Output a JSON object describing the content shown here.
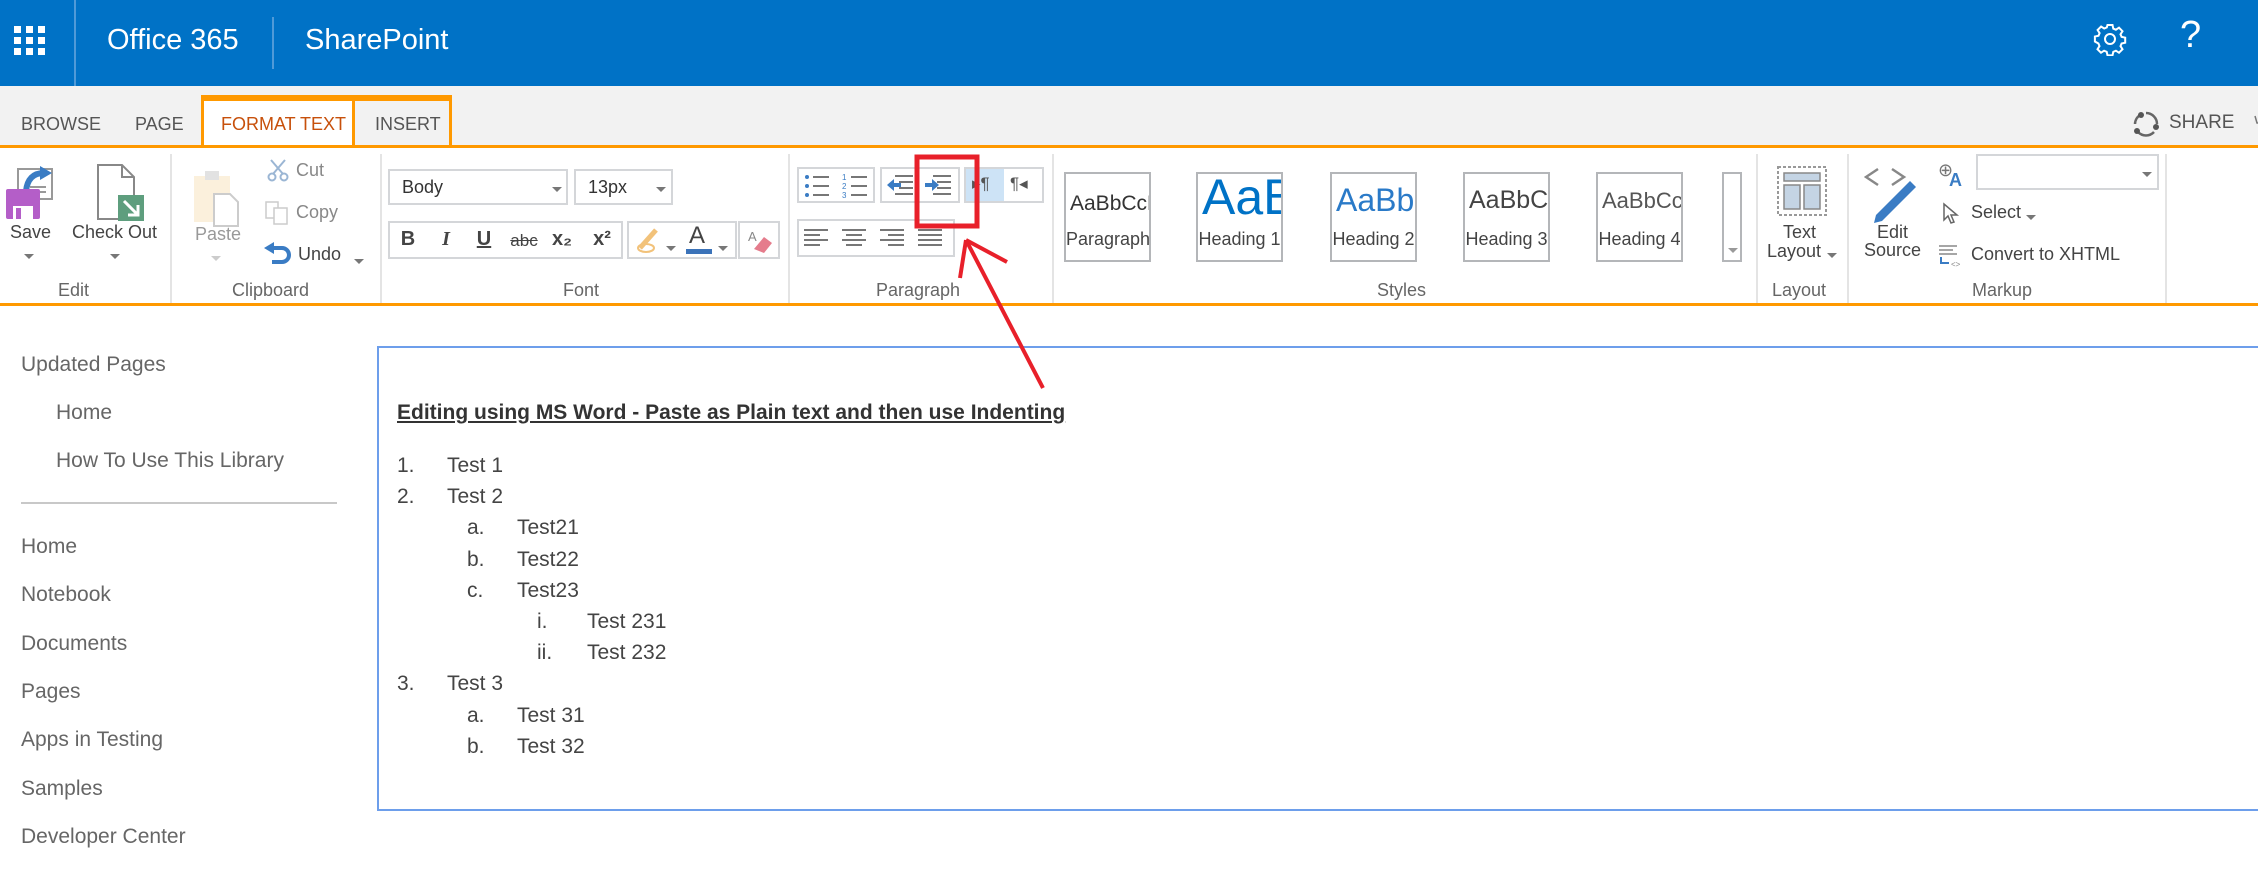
{
  "suitebar": {
    "app_launcher_icon": "waffle-icon",
    "brand": "Office 365",
    "app": "SharePoint",
    "settings_icon": "gear-icon",
    "help_label": "?"
  },
  "tabs": {
    "items": [
      {
        "label": "BROWSE"
      },
      {
        "label": "PAGE"
      },
      {
        "label": "FORMAT TEXT",
        "active": true
      },
      {
        "label": "INSERT"
      }
    ],
    "share_label": "SHARE"
  },
  "ribbon": {
    "edit": {
      "group_label": "Edit",
      "save_label": "Save",
      "checkout_label": "Check Out"
    },
    "clipboard": {
      "group_label": "Clipboard",
      "paste_label": "Paste",
      "cut_label": "Cut",
      "copy_label": "Copy",
      "undo_label": "Undo"
    },
    "font": {
      "group_label": "Font",
      "font_family_value": "Body",
      "font_size_value": "13px",
      "bold_label": "B",
      "italic_label": "I",
      "underline_label": "U",
      "strike_label": "abc",
      "subscript_label": "x₂",
      "superscript_label": "x²",
      "font_color": "#3b73b9"
    },
    "paragraph": {
      "group_label": "Paragraph"
    },
    "styles": {
      "group_label": "Styles",
      "items": [
        {
          "sample": "AaBbCcDdEe",
          "name": "Paragraph",
          "color": "#333333"
        },
        {
          "sample": "AaBb",
          "name": "Heading 1",
          "color": "#0072c6"
        },
        {
          "sample": "AaBbCc",
          "name": "Heading 2",
          "color": "#2a7ac8"
        },
        {
          "sample": "AaBbCcDd",
          "name": "Heading 3",
          "color": "#444444"
        },
        {
          "sample": "AaBbCcDdE",
          "name": "Heading 4",
          "color": "#555555"
        }
      ]
    },
    "layout": {
      "group_label": "Layout",
      "text_layout_line1": "Text",
      "text_layout_line2": "Layout"
    },
    "markup": {
      "group_label": "Markup",
      "edit_source_line1": "Edit",
      "edit_source_line2": "Source",
      "language_value": "",
      "select_label": "Select",
      "convert_label": "Convert to XHTML"
    }
  },
  "nav": {
    "recent_header": "Updated Pages",
    "recent": [
      "Home",
      "How To Use This Library"
    ],
    "items": [
      "Home",
      "Notebook",
      "Documents",
      "Pages",
      "Apps in Testing",
      "Samples",
      "Developer Center"
    ]
  },
  "document": {
    "title": "Editing using MS Word - Paste as Plain text and then use Indenting",
    "list": [
      {
        "marker": "1.",
        "text": "Test 1",
        "level": 0
      },
      {
        "marker": "2.",
        "text": "Test 2",
        "level": 0
      },
      {
        "marker": "a.",
        "text": "Test21",
        "level": 1
      },
      {
        "marker": "b.",
        "text": "Test22",
        "level": 1
      },
      {
        "marker": "c.",
        "text": "Test23",
        "level": 1
      },
      {
        "marker": "i.",
        "text": "Test 231",
        "level": 2
      },
      {
        "marker": "ii.",
        "text": "Test 232",
        "level": 2
      },
      {
        "marker": "3.",
        "text": "Test 3",
        "level": 0
      },
      {
        "marker": "a.",
        "text": "Test 31",
        "level": 1
      },
      {
        "marker": "b.",
        "text": "Test 32",
        "level": 1
      }
    ]
  },
  "annotation": {
    "highlight_target": "increase-indent-button",
    "color": "#e8202a"
  }
}
